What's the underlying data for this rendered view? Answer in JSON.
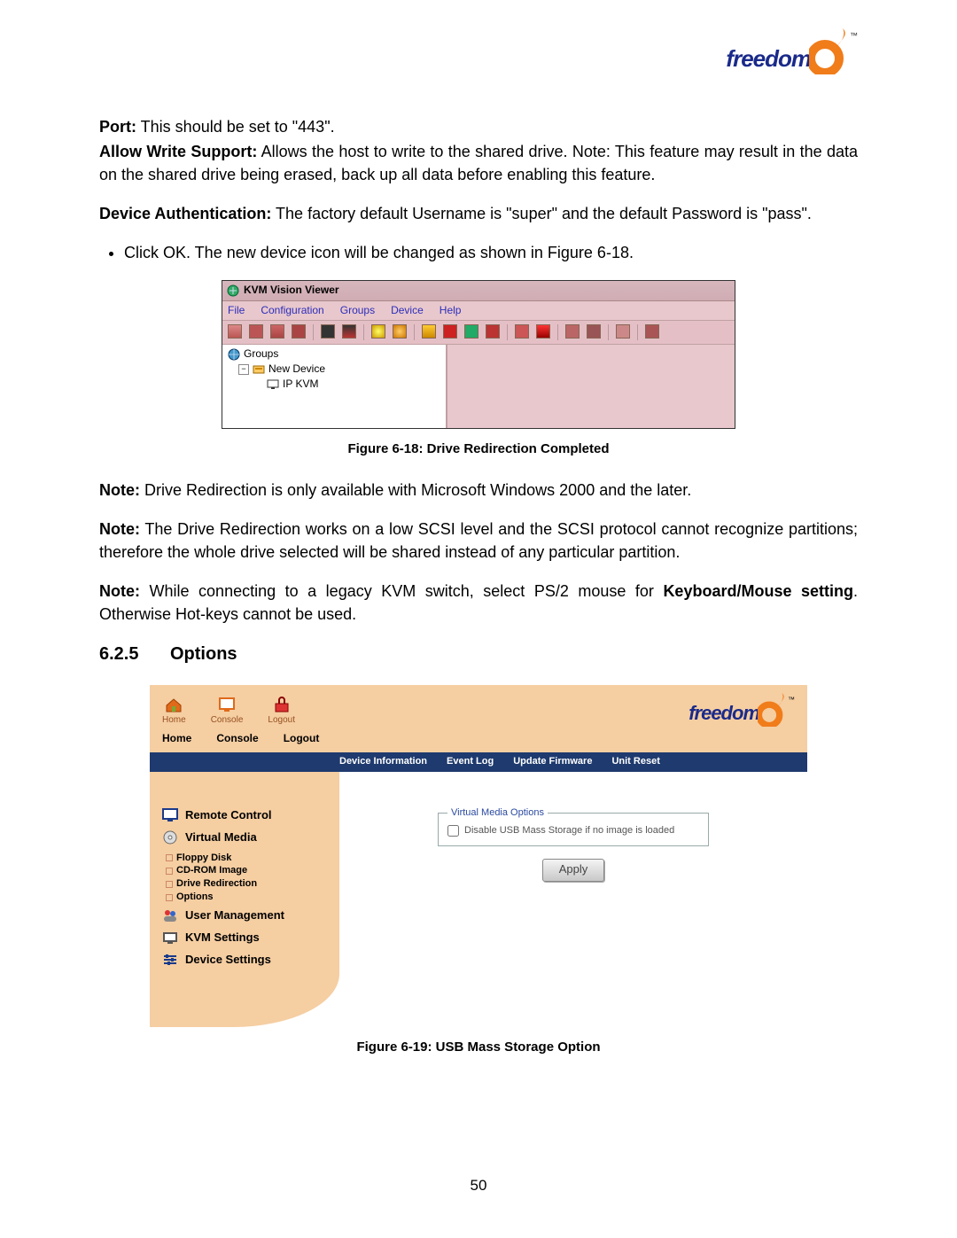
{
  "logo": {
    "text": "freedom"
  },
  "body": {
    "p1": {
      "label": "Port:",
      "text": " This should be set to \"443\"."
    },
    "p2": {
      "label": "Allow Write Support:",
      "text": " Allows the host to write to the shared drive. Note: This feature may result in the data on the shared drive being erased, back up all data before enabling this feature."
    },
    "p3": {
      "label": "Device Authentication:",
      "text": " The factory default Username is \"super\" and the default Password is \"pass\"."
    },
    "bullet1": "Click OK. The new device icon will be changed as shown in Figure 6-18.",
    "fig18_caption": "Figure 6-18: Drive Redirection Completed",
    "p4": {
      "label": "Note:",
      "text": " Drive Redirection is only available with Microsoft Windows 2000 and the later."
    },
    "p5": {
      "label": "Note:",
      "text": " The Drive Redirection works on a low SCSI level and the SCSI protocol cannot recognize partitions; therefore the whole drive selected will be shared instead of any particular partition."
    },
    "p6": {
      "label": "Note:",
      "text_a": " While connecting to a legacy KVM switch, select PS/2 mouse for ",
      "bold": "Keyboard/Mouse setting",
      "text_b": ". Otherwise Hot-keys cannot be used."
    },
    "section": {
      "num": "6.2.5",
      "title": "Options"
    },
    "fig19_caption": "Figure 6-19: USB Mass Storage Option"
  },
  "fig18": {
    "title": "KVM Vision Viewer",
    "menus": [
      "File",
      "Configuration",
      "Groups",
      "Device",
      "Help"
    ],
    "tree": {
      "root": "Groups",
      "child1": "New Device",
      "child2": "IP KVM"
    }
  },
  "fig19": {
    "nav": [
      {
        "key": "home",
        "label": "Home"
      },
      {
        "key": "console",
        "label": "Console"
      },
      {
        "key": "logout",
        "label": "Logout"
      }
    ],
    "nav2": [
      "Home",
      "Console",
      "Logout"
    ],
    "tabs": [
      "Device Information",
      "Event Log",
      "Update Firmware",
      "Unit Reset"
    ],
    "sidebar": {
      "remote": "Remote Control",
      "vmedia": "Virtual Media",
      "vm_sub": [
        "Floppy Disk",
        "CD-ROM Image",
        "Drive Redirection",
        "Options"
      ],
      "usermgmt": "User Management",
      "kvm": "KVM Settings",
      "device": "Device Settings"
    },
    "panel": {
      "legend": "Virtual Media Options",
      "checkbox": "Disable USB Mass Storage if no image is loaded",
      "apply": "Apply"
    }
  },
  "page_number": "50"
}
